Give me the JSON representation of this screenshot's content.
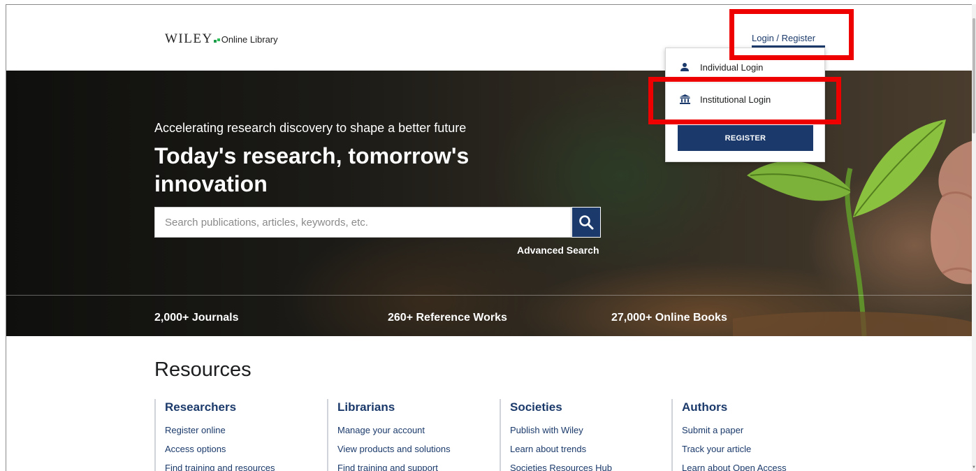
{
  "header": {
    "logo_brand": "WILEY",
    "logo_product": "Online Library",
    "login_label": "Login / Register"
  },
  "dropdown": {
    "individual_login": "Individual Login",
    "institutional_login": "Institutional Login",
    "register_label": "REGISTER"
  },
  "hero": {
    "subtitle": "Accelerating research discovery to shape a better future",
    "title": "Today's research, tomorrow's innovation",
    "search_placeholder": "Search publications, articles, keywords, etc.",
    "advanced_search": "Advanced Search",
    "stats": [
      "2,000+ Journals",
      "260+ Reference Works",
      "27,000+ Online Books"
    ]
  },
  "resources": {
    "title": "Resources",
    "columns": [
      {
        "heading": "Researchers",
        "links": [
          "Register online",
          "Access options",
          "Find training and resources"
        ]
      },
      {
        "heading": "Librarians",
        "links": [
          "Manage your account",
          "View products and solutions",
          "Find training and support"
        ]
      },
      {
        "heading": "Societies",
        "links": [
          "Publish with Wiley",
          "Learn about trends",
          "Societies Resources Hub"
        ]
      },
      {
        "heading": "Authors",
        "links": [
          "Submit a paper",
          "Track your article",
          "Learn about Open Access"
        ]
      }
    ]
  },
  "colors": {
    "brand_navy": "#1b3a6b",
    "highlight_red": "#ee0000",
    "logo_green": "#1d9a4a"
  },
  "icons": [
    "user-icon",
    "institution-icon",
    "search-icon"
  ]
}
